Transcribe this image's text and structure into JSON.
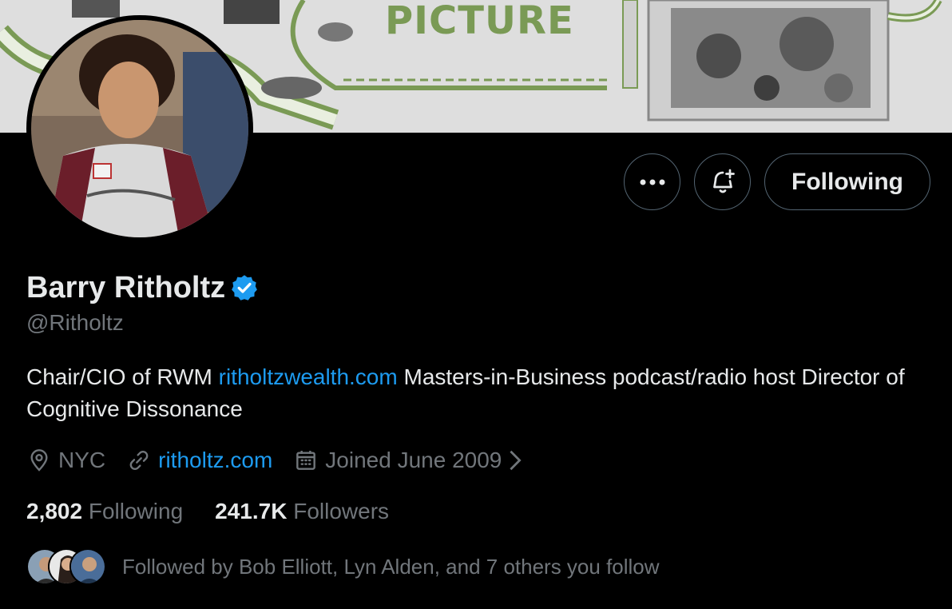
{
  "banner": {
    "title": "PICTURE"
  },
  "actions": {
    "more_label": "More",
    "notify_label": "Turn on notifications",
    "following_label": "Following"
  },
  "profile": {
    "name": "Barry Ritholtz",
    "handle": "@Ritholtz",
    "bio_part1": "Chair/CIO of RWM ",
    "bio_link": "ritholtzwealth.com",
    "bio_part2": " Masters-in-Business podcast/radio host Director of Cognitive Dissonance",
    "location": "NYC",
    "website": "ritholtz.com",
    "joined": "Joined June 2009"
  },
  "counts": {
    "following_num": "2,802",
    "following_label": "Following",
    "followers_num": "241.7K",
    "followers_label": "Followers"
  },
  "followed_by": {
    "text": "Followed by Bob Elliott, Lyn Alden, and 7 others you follow"
  },
  "colors": {
    "accent": "#1d9bf0",
    "muted": "#71767b",
    "text": "#e7e9ea",
    "border": "#536471",
    "banner_green": "#7a9a55"
  },
  "icons": [
    "more-icon",
    "bell-plus-icon",
    "verified-badge-icon",
    "location-icon",
    "link-icon",
    "calendar-icon",
    "chevron-right-icon"
  ]
}
